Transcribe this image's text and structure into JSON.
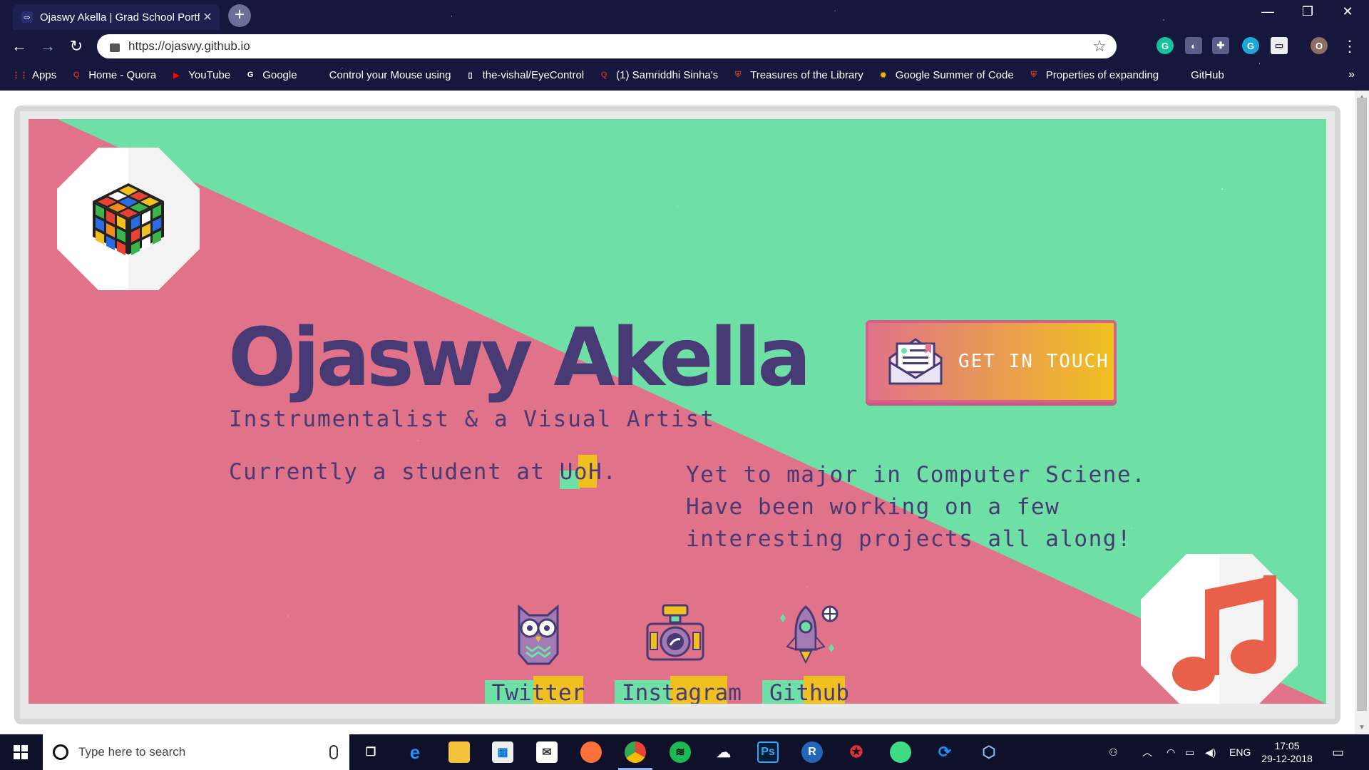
{
  "browser": {
    "tab_title": "Ojaswy Akella | Grad School Portfolio",
    "tab_close": "✕",
    "new_tab": "+",
    "url": "https://ojaswy.github.io",
    "window_controls": [
      "—",
      "❐",
      "✕"
    ],
    "extensions": [
      "G",
      "◐",
      "✚",
      "G",
      "▭",
      "O"
    ],
    "bookmarks": [
      {
        "label": "Apps",
        "icon": "apps-grid-icon",
        "color": "#e94235"
      },
      {
        "label": "Home - Quora",
        "icon": "quora-icon",
        "color": "#b92b27"
      },
      {
        "label": "YouTube",
        "icon": "youtube-icon",
        "color": "#ff0000"
      },
      {
        "label": "Google",
        "icon": "google-icon",
        "color": "#ffffff"
      },
      {
        "label": "Control your Mouse using Eye",
        "icon": "github-icon",
        "color": "#15183c"
      },
      {
        "label": "the-vishal/EyeControl",
        "icon": "page-icon",
        "color": "#ffffff"
      },
      {
        "label": "(1) Samriddhi Sinha's",
        "icon": "quora-icon",
        "color": "#b92b27"
      },
      {
        "label": "Treasures of the Library",
        "icon": "shield-icon",
        "color": "#c0392b"
      },
      {
        "label": "Google Summer of Code",
        "icon": "sun-icon",
        "color": "#f4b400"
      },
      {
        "label": "Properties of expanding",
        "icon": "shield-icon",
        "color": "#c0392b"
      },
      {
        "label": "GitHub",
        "icon": "github-icon",
        "color": "#15183c"
      }
    ],
    "bookmarks_more": "»"
  },
  "page": {
    "name": "Ojaswy Akella",
    "tagline": "Instrumentalist & a Visual Artist",
    "current_prefix": "Currently a student at ",
    "current_highlight": "UoH",
    "current_suffix": ".",
    "bio_lines": [
      "Yet to major in Computer Sciene.",
      "Have been working on a few",
      "interesting projects all along!"
    ],
    "cta_label": "GET IN TOUCH",
    "social": [
      {
        "label": "Twitter",
        "icon": "owl-icon"
      },
      {
        "label": "Instagram",
        "icon": "camera-icon"
      },
      {
        "label": "Github",
        "icon": "rocket-icon"
      }
    ],
    "colors": {
      "green": "#6fe0a5",
      "pink": "#e07289",
      "purple": "#473a75",
      "yellow": "#f0c01f"
    }
  },
  "taskbar": {
    "search_placeholder": "Type here to search",
    "language": "ENG",
    "time": "17:05",
    "date": "29-12-2018",
    "apps": [
      "task-view",
      "edge",
      "file-explorer",
      "store",
      "mail",
      "firefox",
      "chrome",
      "spotify",
      "soundcloud",
      "photoshop",
      "r",
      "network-tool",
      "android-studio",
      "sync",
      "virtualbox"
    ]
  }
}
